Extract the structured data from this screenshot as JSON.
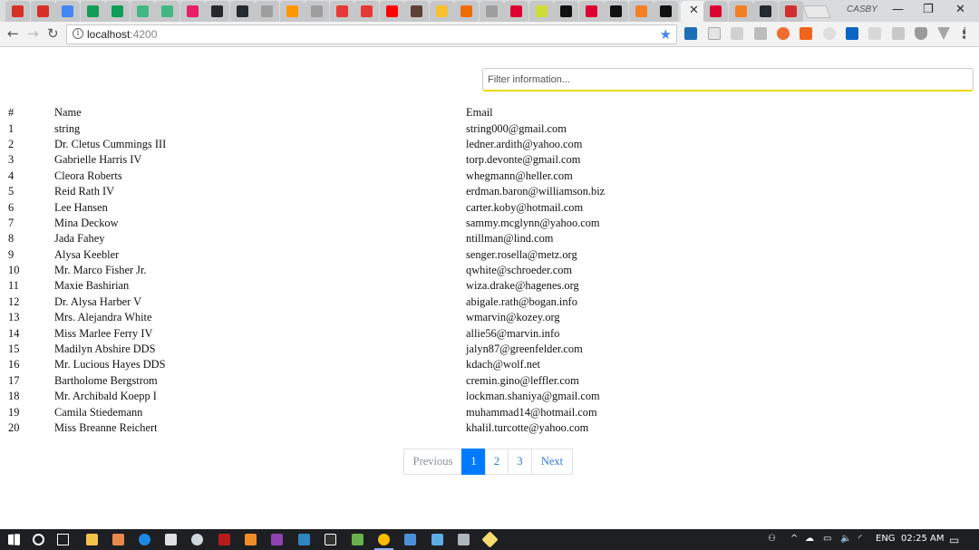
{
  "browser": {
    "tab_favicons": [
      "gmail-icon",
      "gmail-icon",
      "docs-icon",
      "sheets-icon",
      "chat-icon",
      "vue-icon",
      "vue-icon",
      "pie-icon",
      "github-icon",
      "github-icon",
      "page-icon",
      "pwa-icon",
      "page-icon",
      "figure-icon",
      "angular-fire-icon",
      "youtube-icon",
      "book-icon",
      "image-icon",
      "link-icon",
      "page-icon",
      "angular-icon",
      "smile-icon",
      "cp-icon",
      "angular-icon",
      "medium-icon",
      "stackoverflow-icon",
      "medium-icon"
    ],
    "active_tab_close": "✕",
    "after_tabs_favicons": [
      "angular-icon",
      "stackoverflow-icon",
      "github-icon",
      "red-square-icon"
    ],
    "profile_name": "CASBY",
    "window_controls": {
      "minimize": "—",
      "restore": "❐",
      "close": "✕"
    },
    "nav": {
      "back": "←",
      "forward": "→",
      "reload": "↻"
    },
    "url_host": "localhost",
    "url_port": ":4200",
    "info_glyph": "i",
    "bookmark_star": "★"
  },
  "filter": {
    "placeholder": "Filter information..."
  },
  "table": {
    "headers": {
      "id": "#",
      "name": "Name",
      "email": "Email"
    },
    "rows": [
      {
        "id": "1",
        "name": "string",
        "email": "string000@gmail.com"
      },
      {
        "id": "2",
        "name": "Dr. Cletus Cummings III",
        "email": "ledner.ardith@yahoo.com"
      },
      {
        "id": "3",
        "name": "Gabrielle Harris IV",
        "email": "torp.devonte@gmail.com"
      },
      {
        "id": "4",
        "name": "Cleora Roberts",
        "email": "whegmann@heller.com"
      },
      {
        "id": "5",
        "name": "Reid Rath IV",
        "email": "erdman.baron@williamson.biz"
      },
      {
        "id": "6",
        "name": "Lee Hansen",
        "email": "carter.koby@hotmail.com"
      },
      {
        "id": "7",
        "name": "Mina Deckow",
        "email": "sammy.mcglynn@yahoo.com"
      },
      {
        "id": "8",
        "name": "Jada Fahey",
        "email": "ntillman@lind.com"
      },
      {
        "id": "9",
        "name": "Alysa Keebler",
        "email": "senger.rosella@metz.org"
      },
      {
        "id": "10",
        "name": "Mr. Marco Fisher Jr.",
        "email": "qwhite@schroeder.com"
      },
      {
        "id": "11",
        "name": "Maxie Bashirian",
        "email": "wiza.drake@hagenes.org"
      },
      {
        "id": "12",
        "name": "Dr. Alysa Harber V",
        "email": "abigale.rath@bogan.info"
      },
      {
        "id": "13",
        "name": "Mrs. Alejandra White",
        "email": "wmarvin@kozey.org"
      },
      {
        "id": "14",
        "name": "Miss Marlee Ferry IV",
        "email": "allie56@marvin.info"
      },
      {
        "id": "15",
        "name": "Madilyn Abshire DDS",
        "email": "jalyn87@greenfelder.com"
      },
      {
        "id": "16",
        "name": "Mr. Lucious Hayes DDS",
        "email": "kdach@wolf.net"
      },
      {
        "id": "17",
        "name": "Bartholome Bergstrom",
        "email": "cremin.gino@leffler.com"
      },
      {
        "id": "18",
        "name": "Mr. Archibald Koepp I",
        "email": "lockman.shaniya@gmail.com"
      },
      {
        "id": "19",
        "name": "Camila Stiedemann",
        "email": "muhammad14@hotmail.com"
      },
      {
        "id": "20",
        "name": "Miss Breanne Reichert",
        "email": "khalil.turcotte@yahoo.com"
      }
    ]
  },
  "pagination": {
    "previous": "Previous",
    "pages": [
      "1",
      "2",
      "3"
    ],
    "next": "Next",
    "current_page": "1"
  },
  "taskbar": {
    "clock": "02:25 AM",
    "language": "ENG",
    "tray_glyphs": {
      "up_chevron": "^",
      "notifications": "▭"
    }
  },
  "colors": {
    "active_page": "#007bff",
    "link": "#2a7ad8",
    "filter_underline": "#f2d600",
    "taskbar": "#1e1f23"
  }
}
